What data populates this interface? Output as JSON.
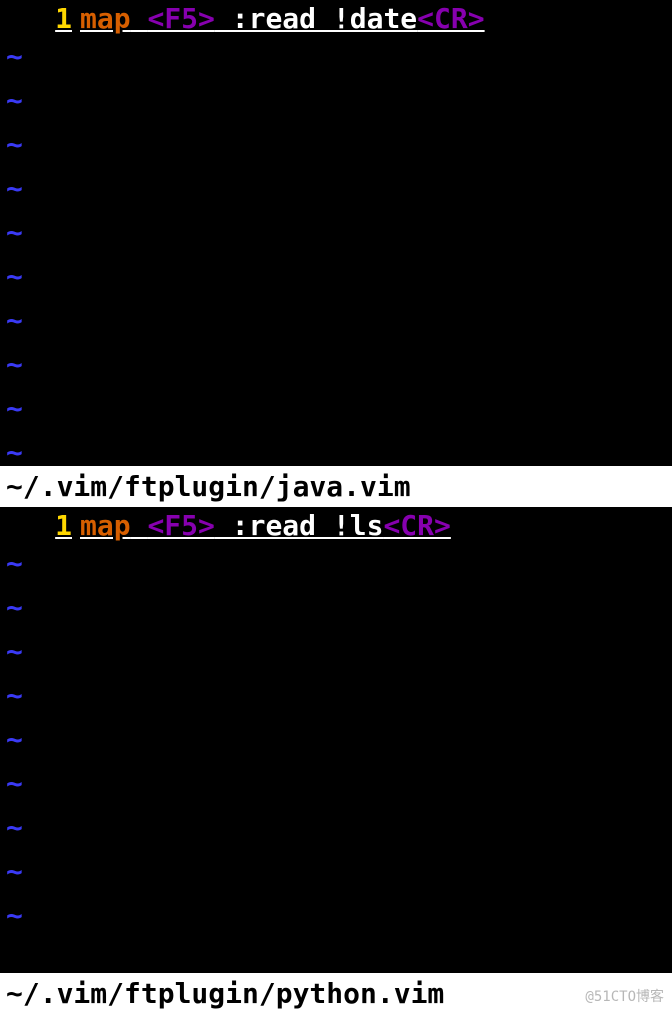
{
  "pane1": {
    "line_num": "1",
    "map_kw": "map",
    "key": "<F5>",
    "cmd": " :read !date",
    "cr": "<CR>",
    "status": "~/.vim/ftplugin/java.vim",
    "tildes": [
      "~",
      "~",
      "~",
      "~",
      "~",
      "~",
      "~",
      "~",
      "~",
      "~"
    ]
  },
  "pane2": {
    "line_num": "1",
    "map_kw": "map",
    "key": "<F5>",
    "cmd": " :read !ls",
    "cr": "<CR>",
    "status": "~/.vim/ftplugin/python.vim",
    "tildes": [
      "~",
      "~",
      "~",
      "~",
      "~",
      "~",
      "~",
      "~",
      "~"
    ]
  },
  "watermark": "@51CTO博客"
}
